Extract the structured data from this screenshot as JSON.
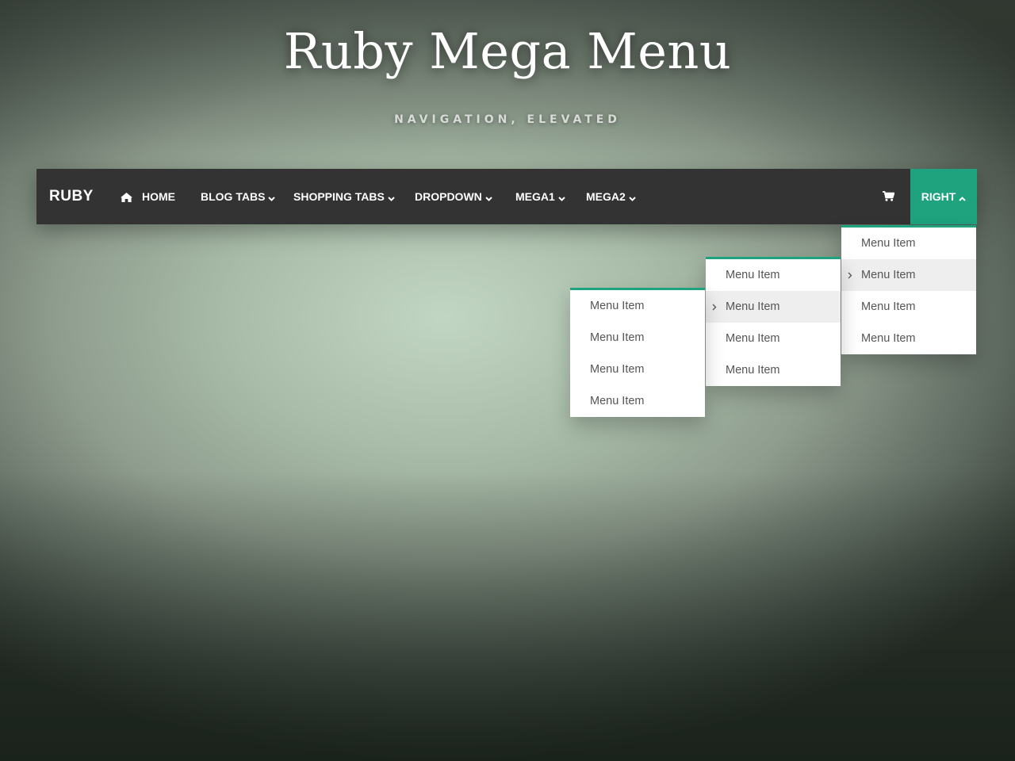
{
  "hero": {
    "title": "Ruby Mega Menu",
    "subtitle": "NAVIGATION, ELEVATED"
  },
  "navbar": {
    "brand": "RUBY",
    "items": [
      {
        "label": "HOME",
        "icon": "home-icon"
      },
      {
        "label": "BLOG TABS",
        "icon": "chevron-down-icon"
      },
      {
        "label": "SHOPPING TABS",
        "icon": "chevron-down-icon"
      },
      {
        "label": "DROPDOWN",
        "icon": "chevron-down-icon"
      },
      {
        "label": "MEGA1",
        "icon": "chevron-down-icon"
      },
      {
        "label": "MEGA2",
        "icon": "chevron-down-icon"
      }
    ],
    "cart_icon": "cart-icon",
    "right": {
      "label": "RIGHT",
      "icon": "chevron-up-icon"
    }
  },
  "dropdown": {
    "level1": [
      {
        "label": "Menu Item",
        "active": false
      },
      {
        "label": "Menu Item",
        "active": true
      },
      {
        "label": "Menu Item",
        "active": false
      },
      {
        "label": "Menu Item",
        "active": false
      }
    ],
    "level2": [
      {
        "label": "Menu Item",
        "active": false
      },
      {
        "label": "Menu Item",
        "active": true
      },
      {
        "label": "Menu Item",
        "active": false
      },
      {
        "label": "Menu Item",
        "active": false
      }
    ],
    "level3": [
      {
        "label": "Menu Item",
        "active": false
      },
      {
        "label": "Menu Item",
        "active": false
      },
      {
        "label": "Menu Item",
        "active": false
      },
      {
        "label": "Menu Item",
        "active": false
      }
    ]
  },
  "colors": {
    "accent": "#1fa37f",
    "navbar_bg": "#333333",
    "menu_text": "#555555",
    "menu_active_bg": "#eeeeee"
  }
}
